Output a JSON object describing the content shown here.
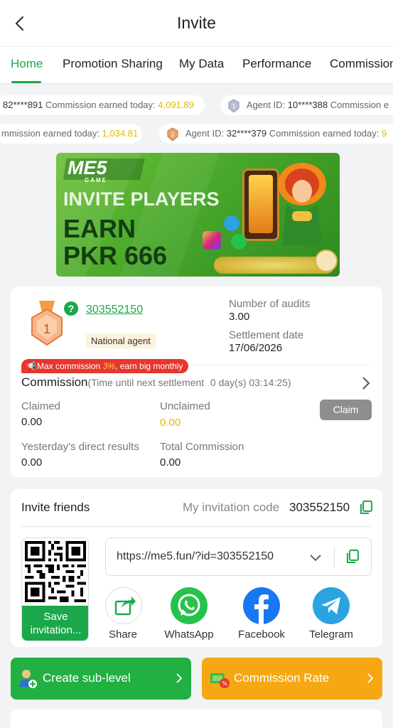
{
  "header": {
    "title": "Invite"
  },
  "tabs": [
    {
      "label": "Home"
    },
    {
      "label": "Promotion Sharing"
    },
    {
      "label": "My Data"
    },
    {
      "label": "Performance"
    },
    {
      "label": "Commission"
    }
  ],
  "ticker": {
    "row1": [
      {
        "id_prefix": "",
        "id": "82****891",
        "label": "Commission earned today:",
        "amount": "4,091.89"
      },
      {
        "id_prefix": "Agent ID:",
        "id": "10****388",
        "label": "Commission e",
        "amount": ""
      }
    ],
    "row2": [
      {
        "label": "mmission earned today:",
        "amount": "1,034.81"
      },
      {
        "id_prefix": "Agent ID:",
        "id": "32****379",
        "label": "Commission earned today:",
        "amount": "9"
      }
    ]
  },
  "banner": {
    "brand": "ME5",
    "brand_sub": "GAME",
    "line1": "INVITE PLAYERS",
    "line2": "EARN",
    "line3": "PKR 666"
  },
  "agent": {
    "level": "1",
    "code": "303552150",
    "type": "National agent",
    "audits_label": "Number of audits",
    "audits_value": "3.00",
    "settlement_label": "Settlement date",
    "settlement_value": "17/06/2026",
    "promo_pre": "Max commission ",
    "promo_pct": "3%",
    "promo_post": ", earn big monthly"
  },
  "commission": {
    "title": "Commission",
    "timer_label": "(Time until next settlement",
    "timer_value": "0 day(s) 03:14:25)",
    "claimed_label": "Claimed",
    "claimed_value": "0.00",
    "unclaimed_label": "Unclaimed",
    "unclaimed_value": "0.00",
    "claim_button": "Claim",
    "yesterday_label": "Yesterday's direct results",
    "yesterday_value": "0.00",
    "total_label": "Total Commission",
    "total_value": "0.00"
  },
  "invite": {
    "title": "Invite friends",
    "code_label": "My invitation code",
    "code_value": "303552150",
    "qr_button": "Save invitation...",
    "link": "https://me5.fun/?id=303552150",
    "share": [
      {
        "label": "Share"
      },
      {
        "label": "WhatsApp"
      },
      {
        "label": "Facebook"
      },
      {
        "label": "Telegram"
      }
    ]
  },
  "actions": {
    "create_sublevel": "Create sub-level",
    "commission_rate": "Commission Rate"
  },
  "colors": {
    "accent": "#1aa84a",
    "orange": "#f7a712",
    "gold": "#e6b800",
    "red": "#e23b2e"
  }
}
